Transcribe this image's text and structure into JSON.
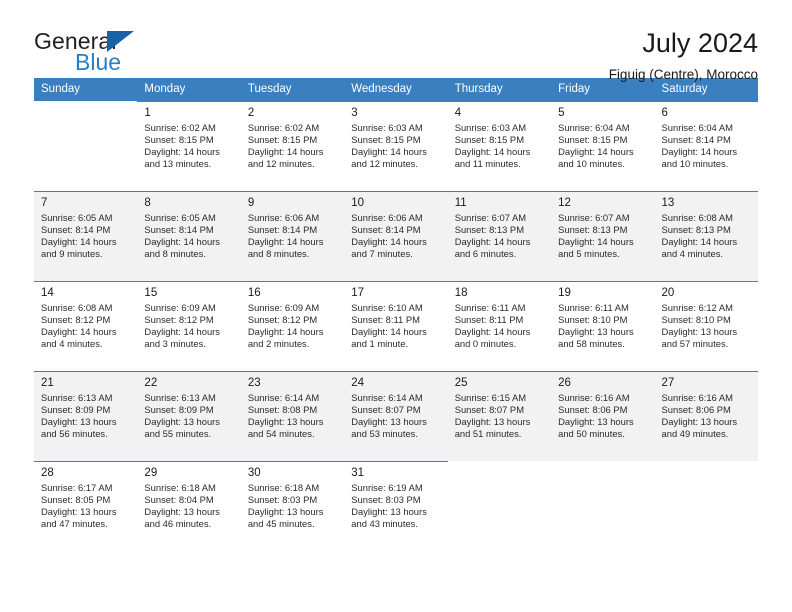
{
  "brand": {
    "line1": "General",
    "line2": "Blue",
    "triangle_color": "#1a62a8",
    "blue_color": "#2a7fc4"
  },
  "header": {
    "title": "July 2024",
    "subtitle": "Figuig (Centre), Morocco"
  },
  "theme": {
    "header_bar": "#3a7fbf",
    "alt_row": "#f2f2f2"
  },
  "weekdays": [
    "Sunday",
    "Monday",
    "Tuesday",
    "Wednesday",
    "Thursday",
    "Friday",
    "Saturday"
  ],
  "weeks": [
    [
      {
        "day": ""
      },
      {
        "day": "1",
        "sunrise": "Sunrise: 6:02 AM",
        "sunset": "Sunset: 8:15 PM",
        "daylight1": "Daylight: 14 hours",
        "daylight2": "and 13 minutes."
      },
      {
        "day": "2",
        "sunrise": "Sunrise: 6:02 AM",
        "sunset": "Sunset: 8:15 PM",
        "daylight1": "Daylight: 14 hours",
        "daylight2": "and 12 minutes."
      },
      {
        "day": "3",
        "sunrise": "Sunrise: 6:03 AM",
        "sunset": "Sunset: 8:15 PM",
        "daylight1": "Daylight: 14 hours",
        "daylight2": "and 12 minutes."
      },
      {
        "day": "4",
        "sunrise": "Sunrise: 6:03 AM",
        "sunset": "Sunset: 8:15 PM",
        "daylight1": "Daylight: 14 hours",
        "daylight2": "and 11 minutes."
      },
      {
        "day": "5",
        "sunrise": "Sunrise: 6:04 AM",
        "sunset": "Sunset: 8:15 PM",
        "daylight1": "Daylight: 14 hours",
        "daylight2": "and 10 minutes."
      },
      {
        "day": "6",
        "sunrise": "Sunrise: 6:04 AM",
        "sunset": "Sunset: 8:14 PM",
        "daylight1": "Daylight: 14 hours",
        "daylight2": "and 10 minutes."
      }
    ],
    [
      {
        "day": "7",
        "sunrise": "Sunrise: 6:05 AM",
        "sunset": "Sunset: 8:14 PM",
        "daylight1": "Daylight: 14 hours",
        "daylight2": "and 9 minutes."
      },
      {
        "day": "8",
        "sunrise": "Sunrise: 6:05 AM",
        "sunset": "Sunset: 8:14 PM",
        "daylight1": "Daylight: 14 hours",
        "daylight2": "and 8 minutes."
      },
      {
        "day": "9",
        "sunrise": "Sunrise: 6:06 AM",
        "sunset": "Sunset: 8:14 PM",
        "daylight1": "Daylight: 14 hours",
        "daylight2": "and 8 minutes."
      },
      {
        "day": "10",
        "sunrise": "Sunrise: 6:06 AM",
        "sunset": "Sunset: 8:14 PM",
        "daylight1": "Daylight: 14 hours",
        "daylight2": "and 7 minutes."
      },
      {
        "day": "11",
        "sunrise": "Sunrise: 6:07 AM",
        "sunset": "Sunset: 8:13 PM",
        "daylight1": "Daylight: 14 hours",
        "daylight2": "and 6 minutes."
      },
      {
        "day": "12",
        "sunrise": "Sunrise: 6:07 AM",
        "sunset": "Sunset: 8:13 PM",
        "daylight1": "Daylight: 14 hours",
        "daylight2": "and 5 minutes."
      },
      {
        "day": "13",
        "sunrise": "Sunrise: 6:08 AM",
        "sunset": "Sunset: 8:13 PM",
        "daylight1": "Daylight: 14 hours",
        "daylight2": "and 4 minutes."
      }
    ],
    [
      {
        "day": "14",
        "sunrise": "Sunrise: 6:08 AM",
        "sunset": "Sunset: 8:12 PM",
        "daylight1": "Daylight: 14 hours",
        "daylight2": "and 4 minutes."
      },
      {
        "day": "15",
        "sunrise": "Sunrise: 6:09 AM",
        "sunset": "Sunset: 8:12 PM",
        "daylight1": "Daylight: 14 hours",
        "daylight2": "and 3 minutes."
      },
      {
        "day": "16",
        "sunrise": "Sunrise: 6:09 AM",
        "sunset": "Sunset: 8:12 PM",
        "daylight1": "Daylight: 14 hours",
        "daylight2": "and 2 minutes."
      },
      {
        "day": "17",
        "sunrise": "Sunrise: 6:10 AM",
        "sunset": "Sunset: 8:11 PM",
        "daylight1": "Daylight: 14 hours",
        "daylight2": "and 1 minute."
      },
      {
        "day": "18",
        "sunrise": "Sunrise: 6:11 AM",
        "sunset": "Sunset: 8:11 PM",
        "daylight1": "Daylight: 14 hours",
        "daylight2": "and 0 minutes."
      },
      {
        "day": "19",
        "sunrise": "Sunrise: 6:11 AM",
        "sunset": "Sunset: 8:10 PM",
        "daylight1": "Daylight: 13 hours",
        "daylight2": "and 58 minutes."
      },
      {
        "day": "20",
        "sunrise": "Sunrise: 6:12 AM",
        "sunset": "Sunset: 8:10 PM",
        "daylight1": "Daylight: 13 hours",
        "daylight2": "and 57 minutes."
      }
    ],
    [
      {
        "day": "21",
        "sunrise": "Sunrise: 6:13 AM",
        "sunset": "Sunset: 8:09 PM",
        "daylight1": "Daylight: 13 hours",
        "daylight2": "and 56 minutes."
      },
      {
        "day": "22",
        "sunrise": "Sunrise: 6:13 AM",
        "sunset": "Sunset: 8:09 PM",
        "daylight1": "Daylight: 13 hours",
        "daylight2": "and 55 minutes."
      },
      {
        "day": "23",
        "sunrise": "Sunrise: 6:14 AM",
        "sunset": "Sunset: 8:08 PM",
        "daylight1": "Daylight: 13 hours",
        "daylight2": "and 54 minutes."
      },
      {
        "day": "24",
        "sunrise": "Sunrise: 6:14 AM",
        "sunset": "Sunset: 8:07 PM",
        "daylight1": "Daylight: 13 hours",
        "daylight2": "and 53 minutes."
      },
      {
        "day": "25",
        "sunrise": "Sunrise: 6:15 AM",
        "sunset": "Sunset: 8:07 PM",
        "daylight1": "Daylight: 13 hours",
        "daylight2": "and 51 minutes."
      },
      {
        "day": "26",
        "sunrise": "Sunrise: 6:16 AM",
        "sunset": "Sunset: 8:06 PM",
        "daylight1": "Daylight: 13 hours",
        "daylight2": "and 50 minutes."
      },
      {
        "day": "27",
        "sunrise": "Sunrise: 6:16 AM",
        "sunset": "Sunset: 8:06 PM",
        "daylight1": "Daylight: 13 hours",
        "daylight2": "and 49 minutes."
      }
    ],
    [
      {
        "day": "28",
        "sunrise": "Sunrise: 6:17 AM",
        "sunset": "Sunset: 8:05 PM",
        "daylight1": "Daylight: 13 hours",
        "daylight2": "and 47 minutes."
      },
      {
        "day": "29",
        "sunrise": "Sunrise: 6:18 AM",
        "sunset": "Sunset: 8:04 PM",
        "daylight1": "Daylight: 13 hours",
        "daylight2": "and 46 minutes."
      },
      {
        "day": "30",
        "sunrise": "Sunrise: 6:18 AM",
        "sunset": "Sunset: 8:03 PM",
        "daylight1": "Daylight: 13 hours",
        "daylight2": "and 45 minutes."
      },
      {
        "day": "31",
        "sunrise": "Sunrise: 6:19 AM",
        "sunset": "Sunset: 8:03 PM",
        "daylight1": "Daylight: 13 hours",
        "daylight2": "and 43 minutes."
      },
      {
        "day": ""
      },
      {
        "day": ""
      },
      {
        "day": ""
      }
    ]
  ]
}
